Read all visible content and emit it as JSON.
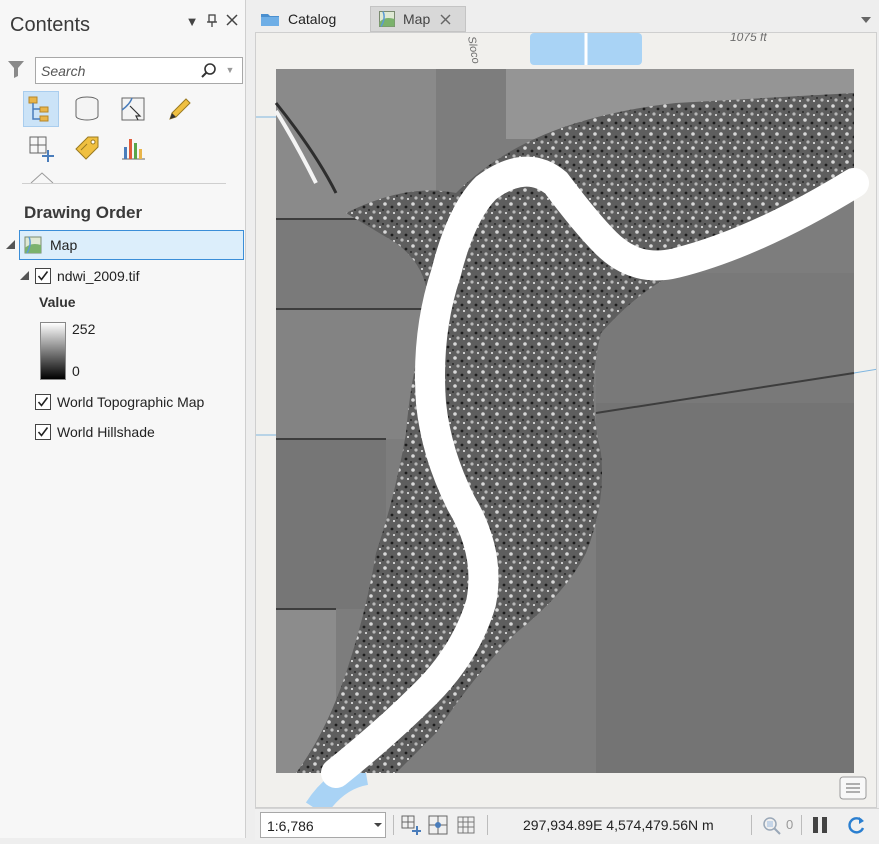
{
  "contents": {
    "title": "Contents",
    "search_placeholder": "Search",
    "section_title": "Drawing Order",
    "tools": [
      "list-by-drawing-order-icon",
      "list-by-data-source-icon",
      "list-by-selection-icon",
      "list-by-editing-icon",
      "list-by-snapping-icon",
      "list-by-labeling-icon",
      "list-by-charts-icon"
    ],
    "layers": {
      "map": "Map",
      "raster": "ndwi_2009.tif",
      "legend_title": "Value",
      "legend_high": "252",
      "legend_low": "0",
      "basemap_topo": "World Topographic Map",
      "basemap_hillshade": "World Hillshade"
    }
  },
  "tabs": [
    {
      "label": "Catalog",
      "icon": "catalog-icon"
    },
    {
      "label": "Map",
      "icon": "map-icon",
      "active": true
    }
  ],
  "map": {
    "basemap_elevation_label": "1075 ft",
    "basemap_road_label": "Sloco"
  },
  "statusbar": {
    "scale": "1:6,786",
    "coordinates": "297,934.89E 4,574,479.56N m",
    "selected_count": "0"
  },
  "colors": {
    "accent": "#3b8ed8",
    "water": "#a9d3f5",
    "selection_bg": "#dceefb"
  }
}
